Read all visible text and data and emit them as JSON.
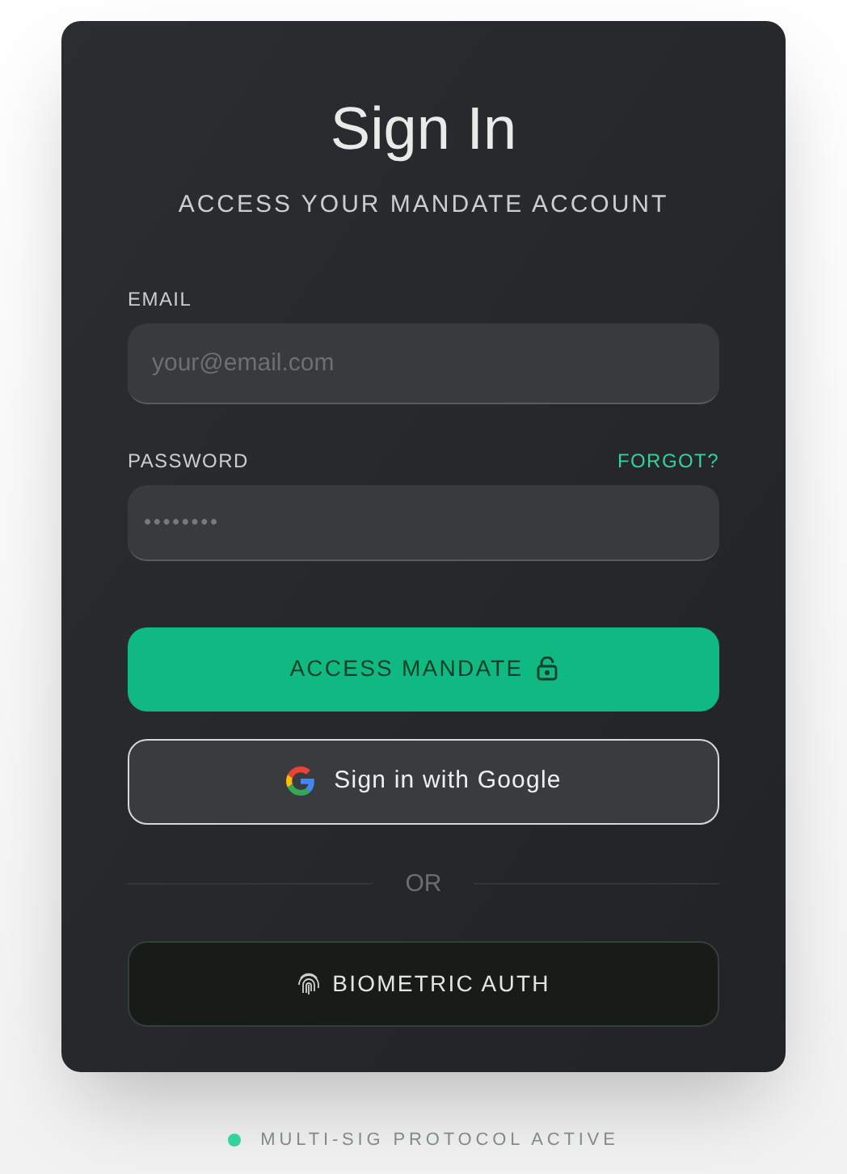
{
  "title": "Sign In",
  "subtitle": "ACCESS YOUR MANDATE ACCOUNT",
  "email": {
    "label": "EMAIL",
    "placeholder": "your@email.com"
  },
  "password": {
    "label": "PASSWORD",
    "forgot": "FORGOT?",
    "value": "••••••••"
  },
  "primary_button": "ACCESS MANDATE",
  "google_button": "Sign in with Google",
  "divider": "OR",
  "biometric_button": "BIOMETRIC AUTH",
  "status": "MULTI-SIG PROTOCOL ACTIVE"
}
